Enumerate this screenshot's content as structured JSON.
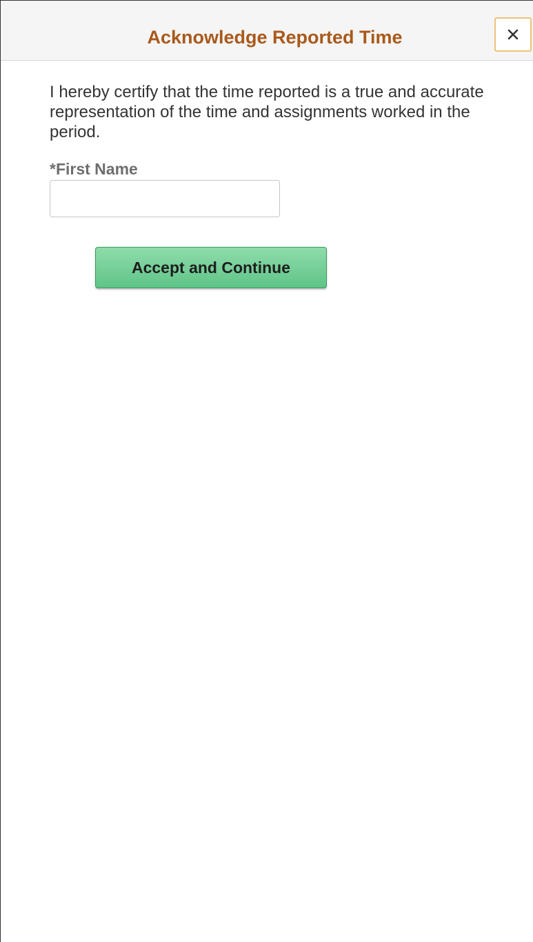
{
  "dialog": {
    "title": "Acknowledge Reported Time",
    "close_icon": "close-icon"
  },
  "form": {
    "certification_text": "I hereby certify that the time reported is a true and accurate representation of the time and assignments worked in the period.",
    "first_name_label": "*First Name",
    "first_name_value": "",
    "accept_label": "Accept and Continue"
  },
  "colors": {
    "title": "#a9591b",
    "close_border": "#eec277",
    "accept_button": "#6fce95",
    "header_background": "#f5f5f5"
  }
}
